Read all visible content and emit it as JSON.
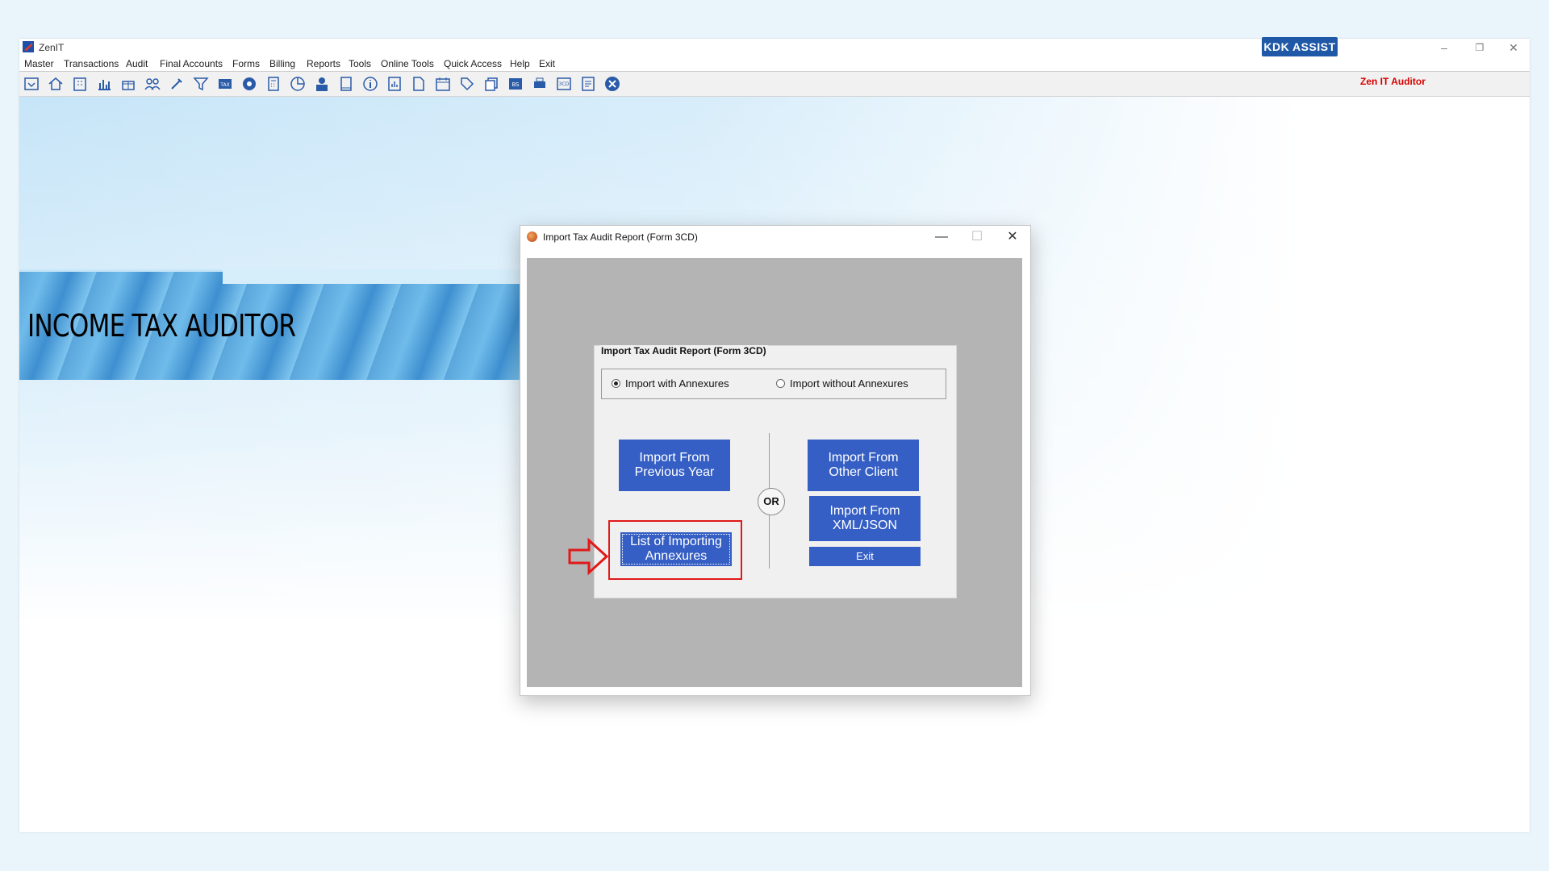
{
  "app": {
    "title": "ZenIT",
    "window_controls": {
      "minimize": "–",
      "restore": "❐",
      "close": "✕"
    }
  },
  "menu": [
    "Master",
    "Transactions",
    "Audit",
    "Final Accounts",
    "Forms",
    "Billing",
    "Reports",
    "Tools",
    "Online Tools",
    "Quick Access",
    "Help",
    "Exit"
  ],
  "toolbar": {
    "icons": [
      "import-icon",
      "home-icon",
      "building-icon",
      "bar-chart-icon",
      "gift-icon",
      "group-icon",
      "tools-icon",
      "filter-icon",
      "tax-icon",
      "disc-icon",
      "calculator-icon",
      "pie-chart-icon",
      "pay-icon",
      "book-icon",
      "info-icon",
      "report-icon",
      "document-icon",
      "calendar-icon",
      "tag-icon",
      "copy-icon",
      "bs-icon",
      "print-icon",
      "3cd-icon",
      "sheet-icon",
      "close-icon"
    ],
    "kdk_label": "KDK ASSIST",
    "product_label": "Zen IT Auditor"
  },
  "banner": {
    "title": "INCOME TAX AUDITOR"
  },
  "dialog": {
    "title": "Import Tax Audit Report (Form 3CD)",
    "controls": {
      "minimize": "—",
      "maximize": "☐",
      "close": "✕"
    },
    "group_label": "Import Tax Audit Report (Form 3CD)",
    "radio_with": "Import with Annexures",
    "radio_without": "Import without Annexures",
    "selected_radio": "with",
    "btn_prev_year": "Import From\nPrevious Year",
    "btn_other_client": "Import From\nOther Client",
    "btn_xml": "Import From\nXML/JSON",
    "btn_list": "List of Importing\nAnnexures",
    "btn_exit": "Exit",
    "or_label": "OR"
  },
  "colors": {
    "button_blue": "#355fc4",
    "highlight_red": "#e01919",
    "kdk_blue": "#1f58a6"
  }
}
